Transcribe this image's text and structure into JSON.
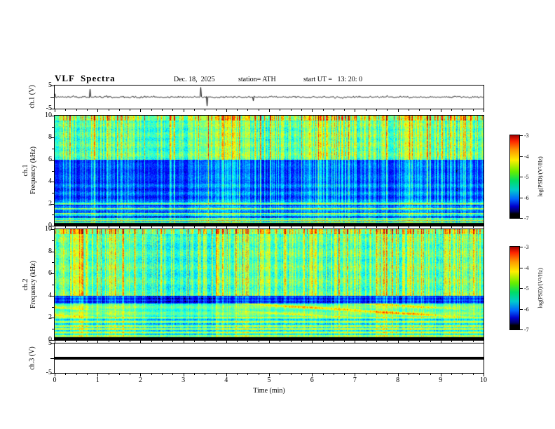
{
  "header": {
    "title": "VLF  Spectra",
    "date": "Dec. 18,  2025",
    "station": "station= ATH",
    "start_ut": "start UT =   13: 20: 0"
  },
  "xaxis": {
    "label": "Time  (min)",
    "ticks": [
      "0",
      "1",
      "2",
      "3",
      "4",
      "5",
      "6",
      "7",
      "8",
      "9",
      "10"
    ]
  },
  "panels": {
    "spec_yticks": [
      0,
      2,
      4,
      6,
      8,
      10
    ],
    "ch1_wave": {
      "label": "ch.1 (V)",
      "ytick_top": "5",
      "ytick_bottom": "-5"
    },
    "ch1_spec": {
      "channel": "ch.1",
      "axis_label": "Frequency  (kHz)"
    },
    "ch2_spec": {
      "channel": "ch.2",
      "axis_label": "Frequency  (kHz)"
    },
    "ch3_wave": {
      "label": "ch.3 (V)",
      "ytick_top": "5",
      "ytick_bottom": "-5"
    }
  },
  "colorbar": {
    "label": "log(PSD)/(V²/Hz)",
    "ticks": [
      "-3",
      "-4",
      "-5",
      "-6",
      "-7"
    ]
  },
  "colors": {
    "background": "#ffffff",
    "axis": "#000000",
    "colormap": "jet-like (black → blue → cyan → green → yellow → red)"
  },
  "chart_data": [
    {
      "type": "line",
      "title": "ch.1 (V) waveform",
      "xlabel": "Time (min)",
      "ylabel": "ch.1 (V)",
      "xlim": [
        0,
        10
      ],
      "ylim": [
        -5,
        5
      ],
      "description": "Noisy broadband waveform fluctuating around 0 V (≈ ±0.5 V) with intermittent impulsive spikes (sferics), mostly downward, reaching about ±4 V throughout the 10-minute record."
    },
    {
      "type": "heatmap",
      "title": "ch.1 spectrogram",
      "xlabel": "Time (min)",
      "ylabel": "Frequency (kHz)",
      "xlim": [
        0,
        10
      ],
      "ylim": [
        0,
        10
      ],
      "colorbar_label": "log(PSD)/(V²/Hz)",
      "zlim": [
        -7,
        -3
      ],
      "description": "Dark-blue background (PSD ≈ -6.5) between 2–6 kHz; green background (≈ -5) above 6 kHz; dense vertical broadband striations (sferics, green-yellow, up to ≈ -4, red specks near 10 kHz) across all frequencies; bright cyan/green horizontal banding below 2 kHz; near-black band (≤ -7) below ~0.3 kHz."
    },
    {
      "type": "heatmap",
      "title": "ch.2 spectrogram",
      "xlabel": "Time (min)",
      "ylabel": "Frequency (kHz)",
      "xlim": [
        0,
        10
      ],
      "ylim": [
        0,
        10
      ],
      "colorbar_label": "log(PSD)/(V²/Hz)",
      "zlim": [
        -7,
        -3
      ],
      "description": "Green background (≈ -5) with dense vertical sferic striations above 4 kHz; dark blue/black horizontal band near 3.3–4 kHz; intermittent yellow-orange enhancements (≈ -4) in the 2–3 kHz band; layered cyan/green horizontal bands below 2 kHz; near-black band below ~0.3 kHz."
    },
    {
      "type": "line",
      "title": "ch.3 (V) waveform",
      "xlabel": "Time (min)",
      "ylabel": "ch.3 (V)",
      "xlim": [
        0,
        10
      ],
      "ylim": [
        -5,
        5
      ],
      "description": "Constant flat trace at 0 V for the whole record (no signal), drawn as a thick black line."
    }
  ]
}
